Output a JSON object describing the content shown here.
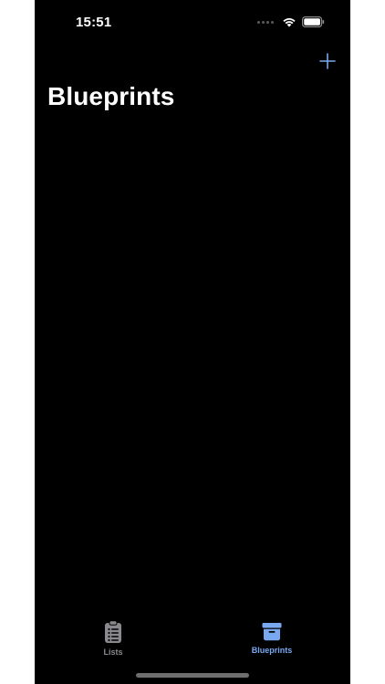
{
  "status_bar": {
    "time": "15:51"
  },
  "navigation": {
    "title": "Blueprints",
    "add_icon": "plus-icon"
  },
  "tabs": [
    {
      "label": "Lists",
      "icon": "clipboard-list-icon",
      "selected": false
    },
    {
      "label": "Blueprints",
      "icon": "archive-box-icon",
      "selected": true
    }
  ],
  "colors": {
    "background": "#000000",
    "accent": "#78a8ef",
    "tab_inactive": "#8a8a8e",
    "text": "#ffffff"
  }
}
